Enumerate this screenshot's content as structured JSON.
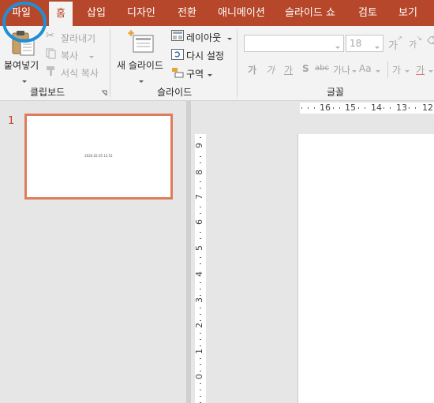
{
  "tabs": [
    "파일",
    "홈",
    "삽입",
    "디자인",
    "전환",
    "애니메이션",
    "슬라이드 쇼",
    "검토",
    "보기"
  ],
  "active_tab": "홈",
  "clipboard": {
    "paste": "붙여넣기",
    "cut": "잘라내기",
    "copy": "복사",
    "format_painter": "서식 복사",
    "group_label": "클립보드"
  },
  "slides_group": {
    "new_slide": "새 슬라이드",
    "layout": "레이아웃",
    "reset": "다시 설정",
    "section": "구역",
    "group_label": "슬라이드"
  },
  "font_group": {
    "font_name": "",
    "font_size": "18",
    "group_label": "글꼴",
    "grow": "가",
    "shrink": "가",
    "bold": "가",
    "italic": "가",
    "underline": "가",
    "shadow": "S",
    "strike": "abc",
    "spacing": "가나",
    "case": "Aa",
    "highlight": "가",
    "color": "가"
  },
  "thumbnail": {
    "number": "1",
    "text": "2020.02.05 12:51"
  },
  "ruler": {
    "horizontal": [
      "16",
      "15",
      "14",
      "13",
      "12"
    ],
    "vertical": [
      "9",
      "8",
      "7",
      "6",
      "5",
      "4",
      "3",
      "2",
      "1",
      "0"
    ]
  },
  "colors": {
    "tab_bar": "#b7472a",
    "ribbon": "#f3f3f3",
    "thumbnail_border": "#e07b5c",
    "highlight_circle": "#1f8fd8"
  }
}
